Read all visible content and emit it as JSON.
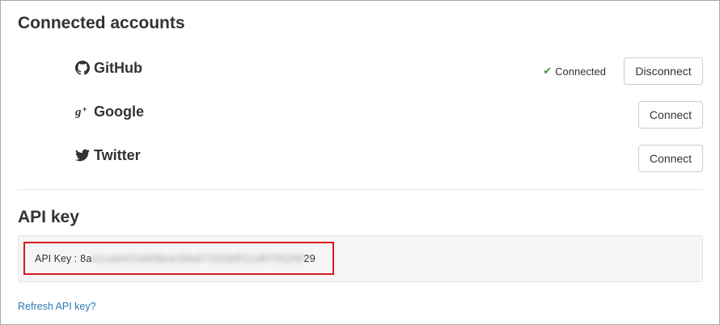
{
  "accounts_section": {
    "title": "Connected accounts",
    "items": [
      {
        "name": "GitHub",
        "icon": "github-icon",
        "status": "Connected",
        "action_label": "Disconnect"
      },
      {
        "name": "Google",
        "icon": "google-plus-icon",
        "status": "",
        "action_label": "Connect"
      },
      {
        "name": "Twitter",
        "icon": "twitter-icon",
        "status": "",
        "action_label": "Connect"
      }
    ]
  },
  "api_section": {
    "title": "API key",
    "key_label": "API Key :",
    "key_prefix": "8a",
    "key_masked": "e1ca0e01dd08eac58a67152ddf11cd0705249",
    "key_suffix": "29",
    "refresh_link": "Refresh API key?"
  },
  "colors": {
    "link": "#2a7ab0",
    "check": "#3c9a3c",
    "highlight_border": "#d9191f",
    "well_background": "#f5f5f5"
  }
}
